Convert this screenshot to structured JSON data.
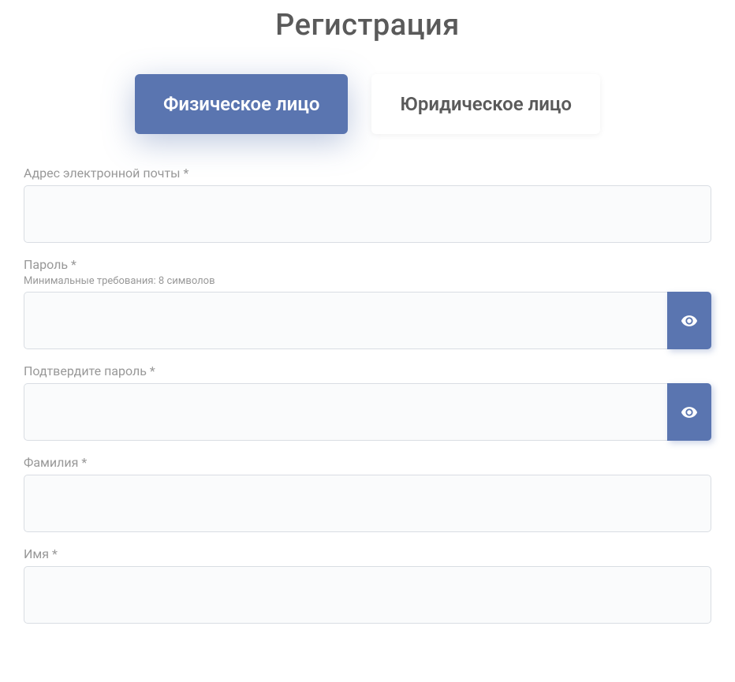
{
  "title": "Регистрация",
  "tabs": {
    "individual": "Физическое лицо",
    "legal": "Юридическое лицо"
  },
  "fields": {
    "email": {
      "label": "Адрес электронной почты *",
      "value": ""
    },
    "password": {
      "label": "Пароль *",
      "hint": "Минимальные требования: 8 символов",
      "value": ""
    },
    "confirmPassword": {
      "label": "Подтвердите пароль *",
      "value": ""
    },
    "lastName": {
      "label": "Фамилия *",
      "value": ""
    },
    "firstName": {
      "label": "Имя *",
      "value": ""
    }
  },
  "colors": {
    "accent": "#5a75b0",
    "textMuted": "#989898",
    "textHeading": "#5a5a5a",
    "inputBorder": "#d9dde3",
    "inputBg": "#fafbfc"
  }
}
